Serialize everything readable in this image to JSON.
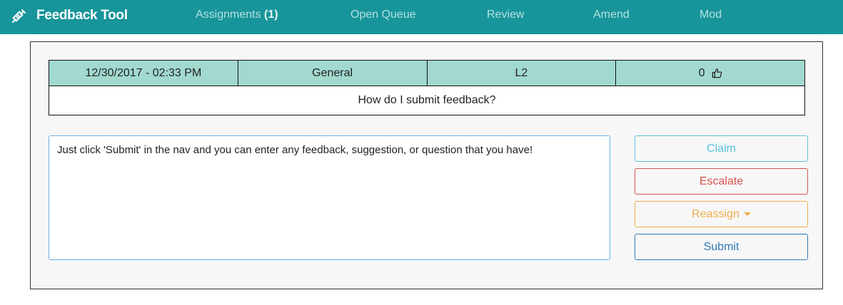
{
  "navbar": {
    "brand": "Feedback Tool",
    "brand_icon": "syringe-icon",
    "links": [
      {
        "label": "Assignments",
        "count": "(1)"
      },
      {
        "label": "Open Queue"
      },
      {
        "label": "Review"
      },
      {
        "label": "Amend"
      },
      {
        "label": "Mod"
      }
    ]
  },
  "feedback": {
    "datetime": "12/30/2017 - 02:33 PM",
    "category": "General",
    "level": "L2",
    "likes": "0",
    "like_icon": "thumbs-up-icon",
    "question": "How do I submit feedback?"
  },
  "answer": {
    "text": "Just click 'Submit' in the nav and you can enter any feedback, suggestion, or question that you have!"
  },
  "actions": {
    "claim": "Claim",
    "escalate": "Escalate",
    "reassign": "Reassign",
    "submit": "Submit"
  },
  "colors": {
    "navbar": "#17959a",
    "table_header": "#a1d9cf",
    "claim": "#5bc0de",
    "escalate": "#d9534f",
    "reassign": "#f0ad4e",
    "submit": "#337ab7"
  }
}
